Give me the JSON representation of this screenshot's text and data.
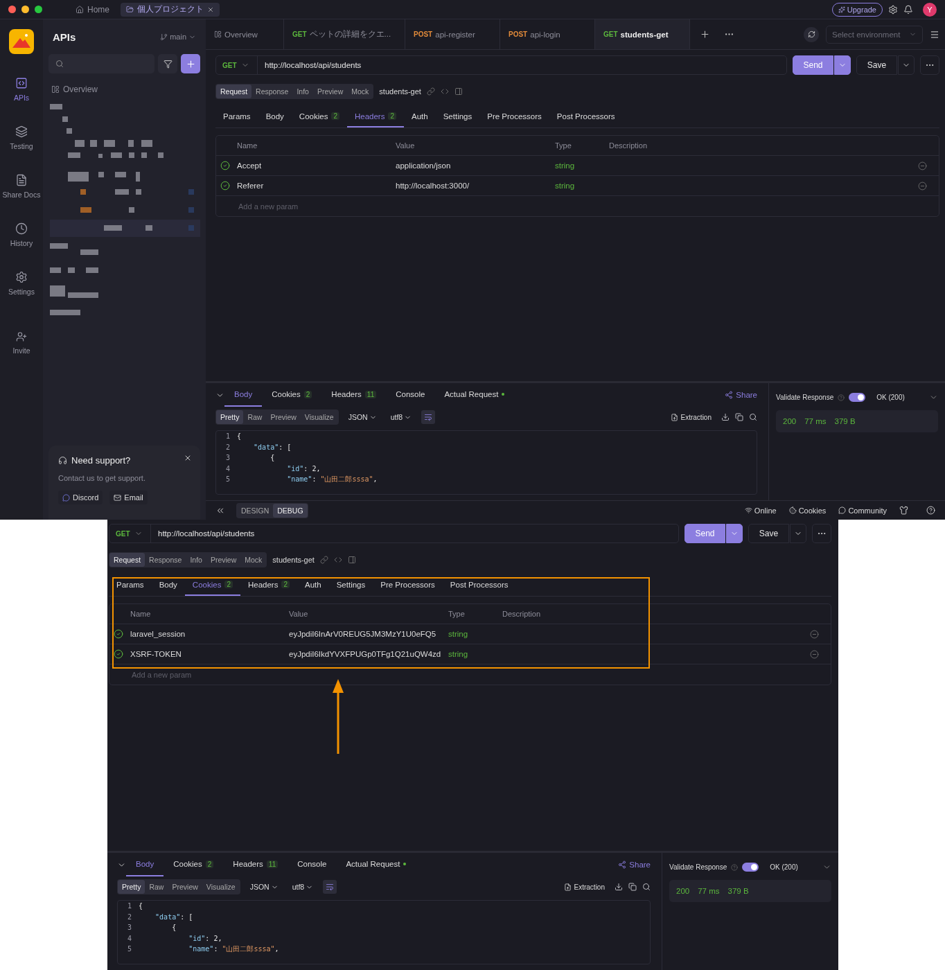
{
  "titlebar": {
    "tabs": [
      {
        "kind": "home",
        "label": "Home",
        "selected": false
      },
      {
        "kind": "project",
        "label": "個人プロジェクト",
        "selected": true
      }
    ],
    "upgrade": "Upgrade",
    "avatar": "Y"
  },
  "rail": {
    "items": [
      {
        "kind": "apis",
        "label": "APIs",
        "selected": true
      },
      {
        "kind": "testing",
        "label": "Testing",
        "selected": false
      },
      {
        "kind": "docs",
        "label": "Share Docs",
        "selected": false
      },
      {
        "kind": "history",
        "label": "History",
        "selected": false
      },
      {
        "kind": "settings",
        "label": "Settings",
        "selected": false
      }
    ],
    "invite": "Invite"
  },
  "sidebar": {
    "title": "APIs",
    "branch": "main",
    "overview": "Overview",
    "support": {
      "title": "Need support?",
      "text": "Contact us to get support.",
      "buttons": [
        {
          "kind": "discord",
          "label": "Discord"
        },
        {
          "kind": "email",
          "label": "Email"
        }
      ]
    }
  },
  "tabs": [
    {
      "label": "Overview",
      "selected": false
    },
    {
      "method": "GET",
      "label": "ペットの詳細をクエ...",
      "selected": false
    },
    {
      "method": "POST",
      "label": "api-register",
      "selected": false
    },
    {
      "method": "POST",
      "label": "api-login",
      "selected": false
    },
    {
      "method": "GET",
      "label": "students-get",
      "selected": true
    }
  ],
  "environment": {
    "placeholder": "Select environment"
  },
  "request": {
    "method": "GET",
    "url": "http://localhost/api/students",
    "send": "Send",
    "save": "Save",
    "modes": [
      {
        "label": "Request",
        "selected": true
      },
      {
        "label": "Response",
        "selected": false
      },
      {
        "label": "Info",
        "selected": false
      },
      {
        "label": "Preview",
        "selected": false
      },
      {
        "label": "Mock",
        "selected": false
      }
    ],
    "name": "students-get",
    "param_tabs": [
      {
        "label": "Params",
        "selected": false
      },
      {
        "label": "Body",
        "selected": false
      },
      {
        "label": "Cookies",
        "count": "2",
        "selected": false
      },
      {
        "label": "Headers",
        "count": "2",
        "selected": true
      },
      {
        "label": "Auth",
        "selected": false
      },
      {
        "label": "Settings",
        "selected": false
      },
      {
        "label": "Pre Processors",
        "selected": false
      },
      {
        "label": "Post Processors",
        "selected": false
      }
    ],
    "columns": [
      "Name",
      "Value",
      "Type",
      "Description"
    ],
    "rows": [
      {
        "checked": true,
        "name": "Accept",
        "value": "application/json",
        "type": "string"
      },
      {
        "checked": true,
        "name": "Referer",
        "value": "http://localhost:3000/",
        "type": "string"
      }
    ],
    "placeholder": "Add a new param"
  },
  "response": {
    "tabs": [
      {
        "label": "Body",
        "dot": false,
        "selected": true
      },
      {
        "label": "Cookies",
        "count": "2",
        "dot": false,
        "selected": false
      },
      {
        "label": "Headers",
        "count": "11",
        "dot": false,
        "selected": false
      },
      {
        "label": "Console",
        "dot": false,
        "selected": false
      },
      {
        "label": "Actual Request",
        "dot": true,
        "selected": false
      }
    ],
    "share": "Share",
    "views": [
      {
        "label": "Pretty",
        "selected": true
      },
      {
        "label": "Raw",
        "selected": false
      },
      {
        "label": "Preview",
        "selected": false
      },
      {
        "label": "Visualize",
        "selected": false
      }
    ],
    "format": "JSON",
    "encoding": "utf8",
    "extraction": "Extraction",
    "code": [
      {
        "no": "1",
        "tokens": [
          {
            "kind": "punct",
            "text": "{"
          }
        ]
      },
      {
        "no": "2",
        "tokens": [
          {
            "kind": "key",
            "text": "    \"data\""
          },
          {
            "kind": "punct",
            "text": ": ["
          }
        ]
      },
      {
        "no": "3",
        "tokens": [
          {
            "kind": "punct",
            "text": "        {"
          }
        ]
      },
      {
        "no": "4",
        "tokens": [
          {
            "kind": "key",
            "text": "            \"id\""
          },
          {
            "kind": "punct",
            "text": ": "
          },
          {
            "kind": "number",
            "text": "2"
          },
          {
            "kind": "punct",
            "text": ","
          }
        ]
      },
      {
        "no": "5",
        "tokens": [
          {
            "kind": "key",
            "text": "            \"name\""
          },
          {
            "kind": "punct",
            "text": ": "
          },
          {
            "kind": "string",
            "text": "\"山田二郎sssa\""
          },
          {
            "kind": "punct",
            "text": ","
          }
        ]
      }
    ],
    "validate": "Validate Response",
    "validate_on": true,
    "status_select": "OK (200)",
    "stats": [
      "200",
      "77 ms",
      "379 B"
    ]
  },
  "statusbar": {
    "modes": [
      {
        "label": "DESIGN",
        "selected": false
      },
      {
        "label": "DEBUG",
        "selected": true
      }
    ],
    "items": [
      {
        "kind": "online",
        "label": "Online"
      },
      {
        "kind": "cookies",
        "label": "Cookies"
      },
      {
        "kind": "community",
        "label": "Community"
      }
    ]
  },
  "second": {
    "request": {
      "method": "GET",
      "url": "http://localhost/api/students",
      "send": "Send",
      "save": "Save",
      "modes": [
        {
          "label": "Request",
          "selected": true
        },
        {
          "label": "Response",
          "selected": false
        },
        {
          "label": "Info",
          "selected": false
        },
        {
          "label": "Preview",
          "selected": false
        },
        {
          "label": "Mock",
          "selected": false
        }
      ],
      "name": "students-get",
      "param_tabs": [
        {
          "label": "Params",
          "selected": false
        },
        {
          "label": "Body",
          "selected": false
        },
        {
          "label": "Cookies",
          "count": "2",
          "selected": true
        },
        {
          "label": "Headers",
          "count": "2",
          "selected": false
        },
        {
          "label": "Auth",
          "selected": false
        },
        {
          "label": "Settings",
          "selected": false
        },
        {
          "label": "Pre Processors",
          "selected": false
        },
        {
          "label": "Post Processors",
          "selected": false
        }
      ],
      "columns": [
        "Name",
        "Value",
        "Type",
        "Description"
      ],
      "rows": [
        {
          "checked": true,
          "name": "laravel_session",
          "value": "eyJpdiI6InArV0REUG5JM3MzY1U0eFQ5",
          "type": "string"
        },
        {
          "checked": true,
          "name": "XSRF-TOKEN",
          "value": "eyJpdiI6IkdYVXFPUGp0TFg1Q21uQW4zd",
          "type": "string"
        }
      ],
      "placeholder": "Add a new param"
    },
    "response": {
      "tabs": [
        {
          "label": "Body",
          "dot": false,
          "selected": true
        },
        {
          "label": "Cookies",
          "count": "2",
          "dot": false,
          "selected": false
        },
        {
          "label": "Headers",
          "count": "11",
          "dot": false,
          "selected": false
        },
        {
          "label": "Console",
          "dot": false,
          "selected": false
        },
        {
          "label": "Actual Request",
          "dot": true,
          "selected": false
        }
      ],
      "share": "Share",
      "views": [
        {
          "label": "Pretty",
          "selected": true
        },
        {
          "label": "Raw",
          "selected": false
        },
        {
          "label": "Preview",
          "selected": false
        },
        {
          "label": "Visualize",
          "selected": false
        }
      ],
      "format": "JSON",
      "encoding": "utf8",
      "extraction": "Extraction",
      "code": [
        {
          "no": "1",
          "tokens": [
            {
              "kind": "punct",
              "text": "{"
            }
          ]
        },
        {
          "no": "2",
          "tokens": [
            {
              "kind": "key",
              "text": "    \"data\""
            },
            {
              "kind": "punct",
              "text": ": ["
            }
          ]
        },
        {
          "no": "3",
          "tokens": [
            {
              "kind": "punct",
              "text": "        {"
            }
          ]
        },
        {
          "no": "4",
          "tokens": [
            {
              "kind": "key",
              "text": "            \"id\""
            },
            {
              "kind": "punct",
              "text": ": "
            },
            {
              "kind": "number",
              "text": "2"
            },
            {
              "kind": "punct",
              "text": ","
            }
          ]
        },
        {
          "no": "5",
          "tokens": [
            {
              "kind": "key",
              "text": "            \"name\""
            },
            {
              "kind": "punct",
              "text": ": "
            },
            {
              "kind": "string",
              "text": "\"山田二郎sssa\""
            },
            {
              "kind": "punct",
              "text": ","
            }
          ]
        }
      ],
      "validate": "Validate Response",
      "validate_on": true,
      "status_select": "OK (200)",
      "stats": [
        "200",
        "77 ms",
        "379 B"
      ]
    }
  }
}
